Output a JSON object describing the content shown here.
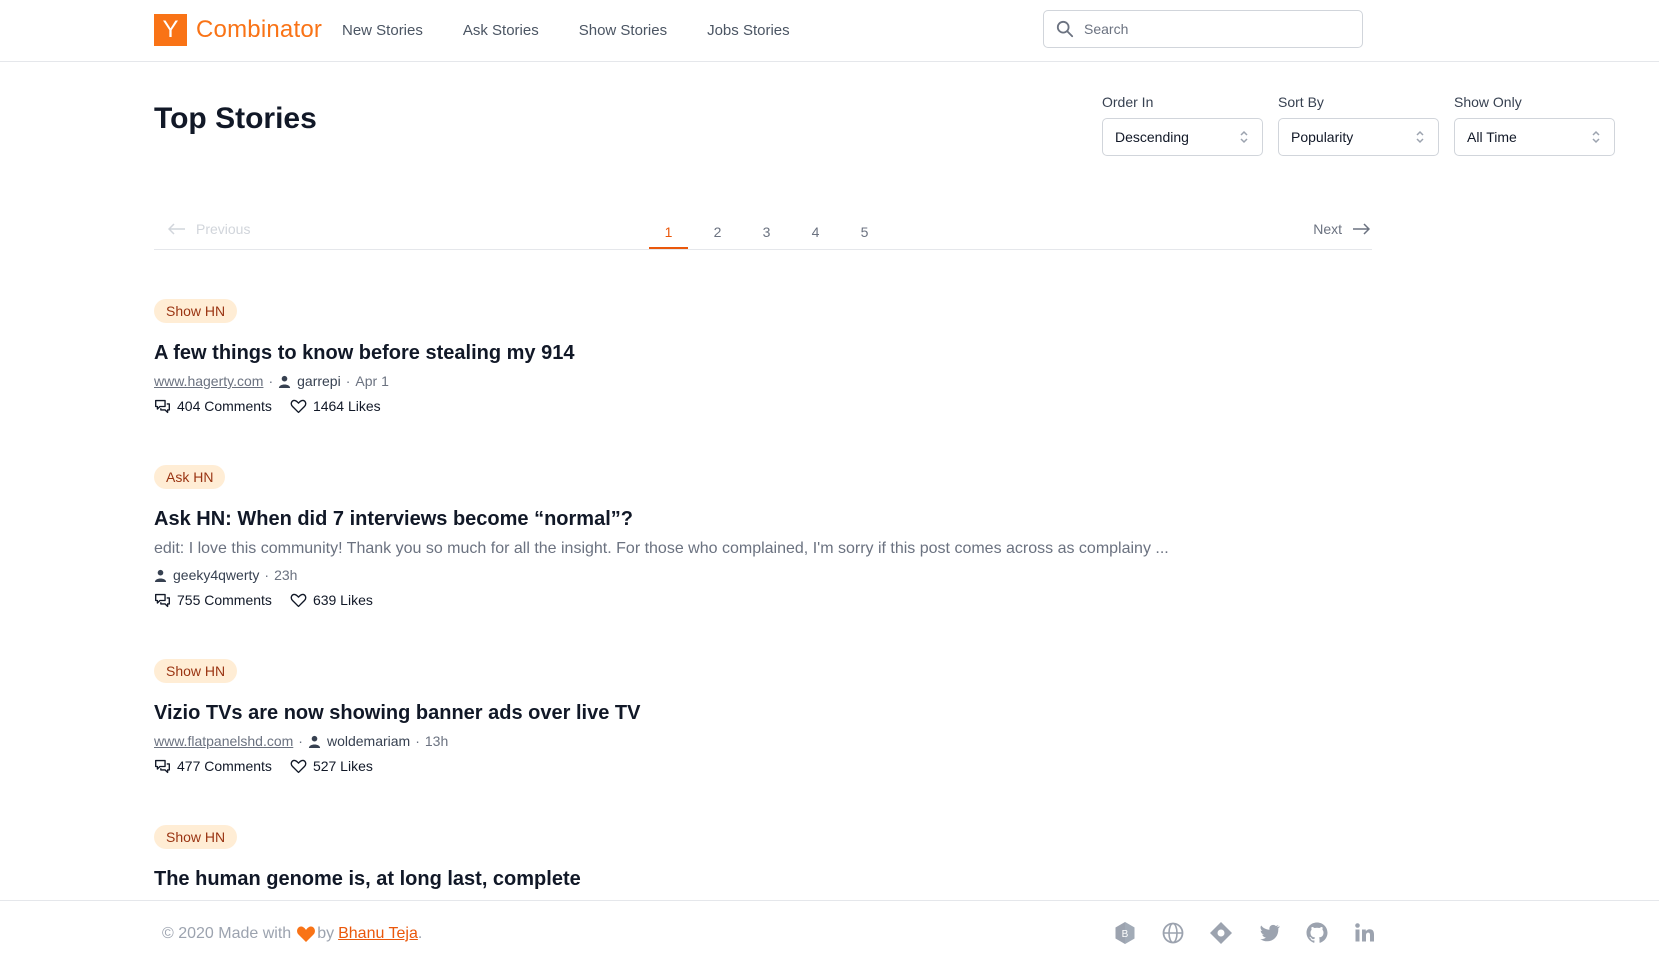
{
  "header": {
    "logo_letter": "Y",
    "logo_text": "Combinator",
    "nav": [
      "New Stories",
      "Ask Stories",
      "Show Stories",
      "Jobs Stories"
    ],
    "search_placeholder": "Search"
  },
  "page_title": "Top Stories",
  "filters": [
    {
      "label": "Order In",
      "value": "Descending"
    },
    {
      "label": "Sort By",
      "value": "Popularity"
    },
    {
      "label": "Show Only",
      "value": "All Time"
    }
  ],
  "pagination": {
    "previous": "Previous",
    "next": "Next",
    "pages": [
      "1",
      "2",
      "3",
      "4",
      "5"
    ],
    "active": "1"
  },
  "stories": [
    {
      "badge": "Show HN",
      "title": "A few things to know before stealing my 914",
      "domain": "www.hagerty.com",
      "user": "garrepi",
      "time": "Apr 1",
      "comments": "404 Comments",
      "likes": "1464 Likes"
    },
    {
      "badge": "Ask HN",
      "title": "Ask HN: When did 7 interviews become “normal”?",
      "text": "edit: I love this community! Thank you so much for all the insight. For those who complained, I'm sorry if this post comes across as complainy ...",
      "user": "geeky4qwerty",
      "time": "23h",
      "comments": "755 Comments",
      "likes": "639 Likes"
    },
    {
      "badge": "Show HN",
      "title": "Vizio TVs are now showing banner ads over live TV",
      "domain": "www.flatpanelshd.com",
      "user": "woldemariam",
      "time": "13h",
      "comments": "477 Comments",
      "likes": "527 Likes"
    },
    {
      "badge": "Show HN",
      "title": "The human genome is, at long last, complete"
    }
  ],
  "footer": {
    "prefix": "© 2020 Made with",
    "by": "by",
    "author": "Bhanu Teja",
    "suffix": ".",
    "heart_color": "#f97316",
    "socials": [
      "hashnode-icon",
      "globe-icon",
      "dev-icon",
      "twitter-icon",
      "github-icon",
      "linkedin-icon"
    ]
  },
  "colors": {
    "accent": "#ea580c",
    "logo": "#f97316",
    "badge_bg": "#ffedd5",
    "badge_text": "#9a3412"
  }
}
